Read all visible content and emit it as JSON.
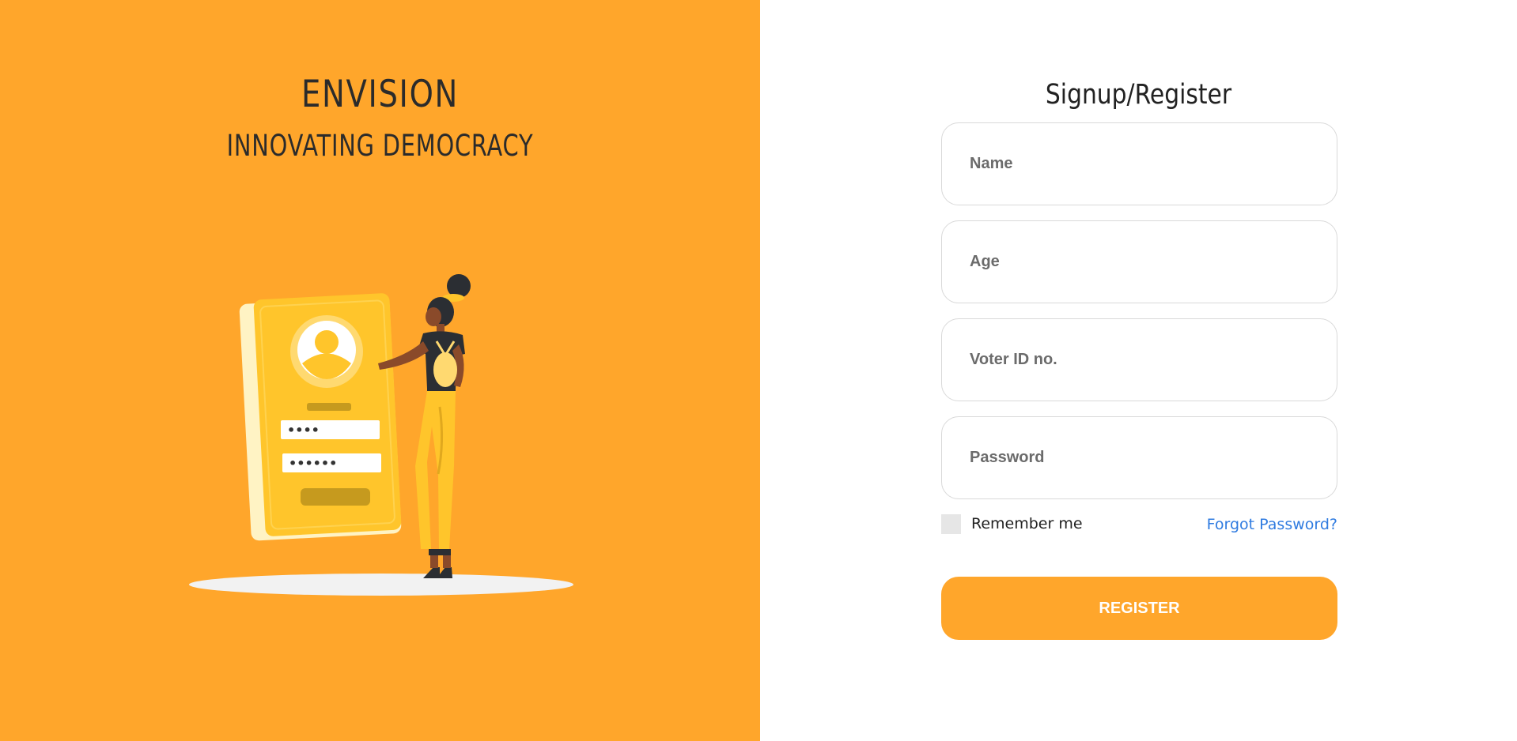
{
  "brand": {
    "title": "ENVISION",
    "tagline": "INNOVATING DEMOCRACY"
  },
  "illustration": {
    "name": "person-with-phone-login-illustration",
    "password_dots_1": "••••",
    "password_dots_2": "••••••"
  },
  "form": {
    "title": "Signup/Register",
    "fields": [
      {
        "name": "name",
        "placeholder": "Name",
        "value": ""
      },
      {
        "name": "age",
        "placeholder": "Age",
        "value": ""
      },
      {
        "name": "voter-id",
        "placeholder": "Voter ID no.",
        "value": ""
      },
      {
        "name": "password",
        "placeholder": "Password",
        "value": ""
      }
    ],
    "remember_label": "Remember me",
    "remember_checked": false,
    "forgot_label": "Forgot Password?",
    "submit_label": "REGISTER"
  },
  "colors": {
    "accent": "#FFA62B",
    "link": "#2f7be0",
    "text_dark": "#2b2b2b"
  }
}
